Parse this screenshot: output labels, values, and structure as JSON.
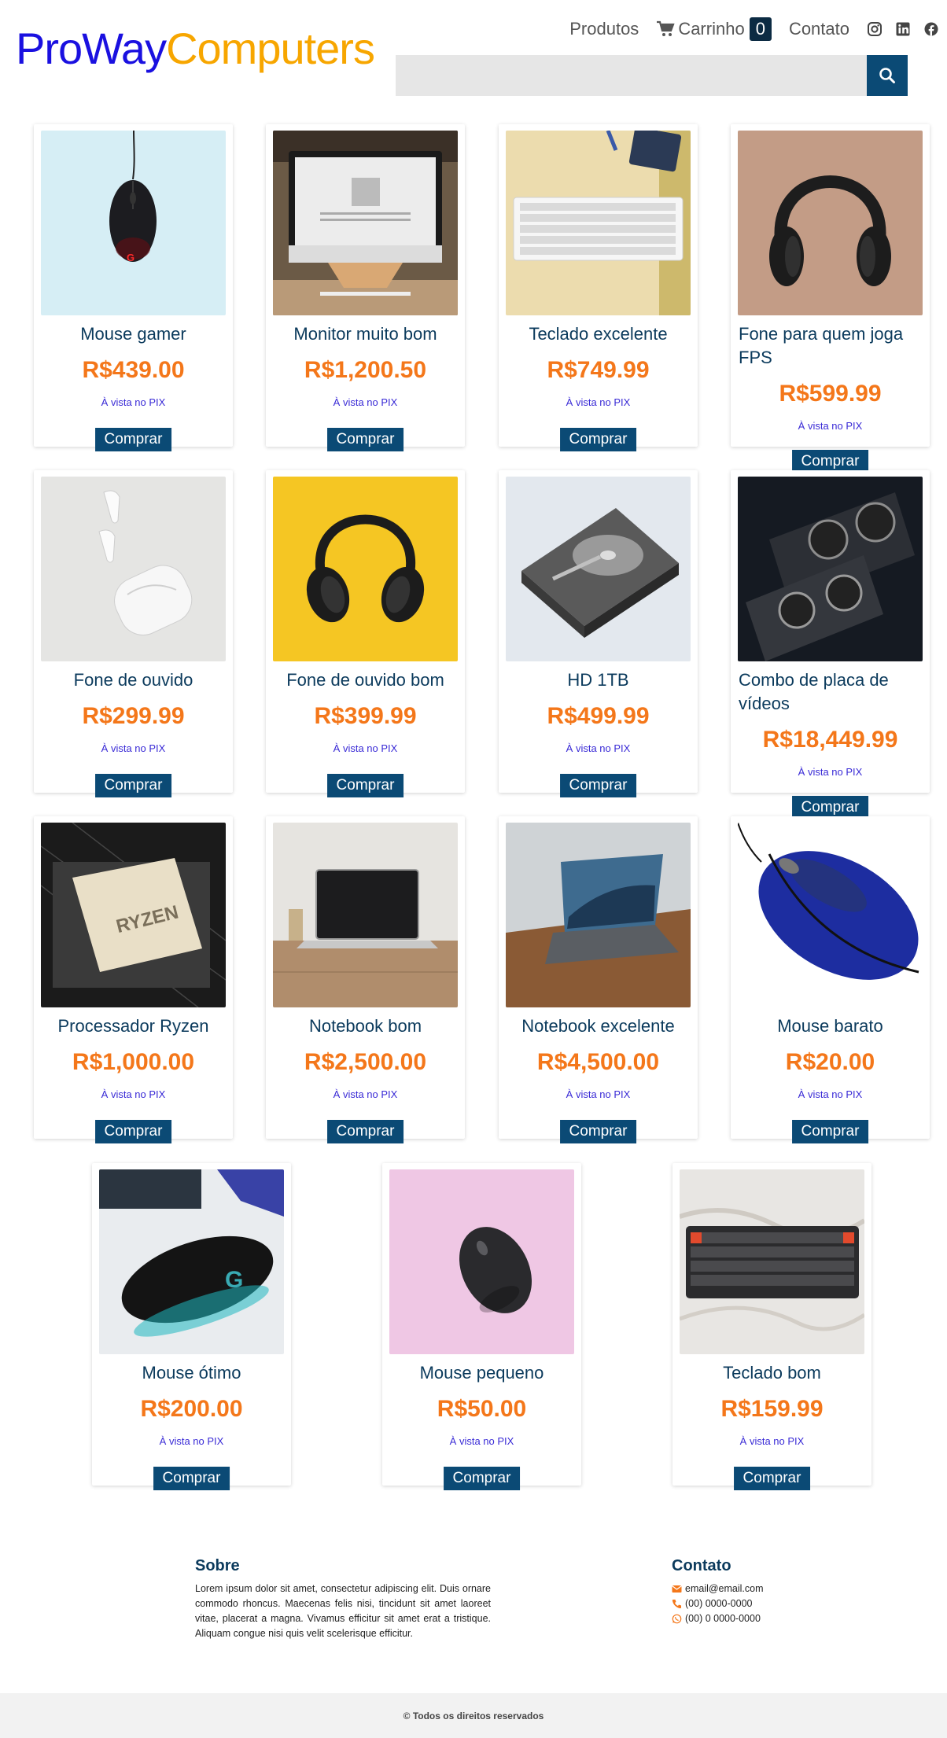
{
  "header": {
    "logo_part1": "ProWay",
    "logo_part2": "Computers",
    "nav": {
      "products": "Produtos",
      "cart": "Carrinho",
      "cart_count": "0",
      "contact": "Contato"
    },
    "social_icons": [
      "instagram-icon",
      "linkedin-icon",
      "facebook-icon"
    ],
    "search": {
      "placeholder": "",
      "value": ""
    }
  },
  "colors": {
    "logo_blue": "#1a10e0",
    "logo_orange": "#f7a600",
    "primary": "#0b4a75",
    "price": "#f4771a",
    "pix": "#3a2bd6"
  },
  "products": [
    {
      "name": "Mouse gamer",
      "price": "R$439.00",
      "pix": "À vista no PIX",
      "button": "Comprar"
    },
    {
      "name": "Monitor muito bom",
      "price": "R$1,200.50",
      "pix": "À vista no PIX",
      "button": "Comprar"
    },
    {
      "name": "Teclado excelente",
      "price": "R$749.99",
      "pix": "À vista no PIX",
      "button": "Comprar"
    },
    {
      "name": "Fone para quem joga FPS",
      "price": "R$599.99",
      "pix": "À vista no PIX",
      "button": "Comprar"
    },
    {
      "name": "Fone de ouvido",
      "price": "R$299.99",
      "pix": "À vista no PIX",
      "button": "Comprar"
    },
    {
      "name": "Fone de ouvido bom",
      "price": "R$399.99",
      "pix": "À vista no PIX",
      "button": "Comprar"
    },
    {
      "name": "HD 1TB",
      "price": "R$499.99",
      "pix": "À vista no PIX",
      "button": "Comprar"
    },
    {
      "name": "Combo de placa de vídeos",
      "price": "R$18,449.99",
      "pix": "À vista no PIX",
      "button": "Comprar"
    },
    {
      "name": "Processador Ryzen",
      "price": "R$1,000.00",
      "pix": "À vista no PIX",
      "button": "Comprar"
    },
    {
      "name": "Notebook bom",
      "price": "R$2,500.00",
      "pix": "À vista no PIX",
      "button": "Comprar"
    },
    {
      "name": "Notebook excelente",
      "price": "R$4,500.00",
      "pix": "À vista no PIX",
      "button": "Comprar"
    },
    {
      "name": "Mouse barato",
      "price": "R$20.00",
      "pix": "À vista no PIX",
      "button": "Comprar"
    },
    {
      "name": "Mouse ótimo",
      "price": "R$200.00",
      "pix": "À vista no PIX",
      "button": "Comprar"
    },
    {
      "name": "Mouse pequeno",
      "price": "R$50.00",
      "pix": "À vista no PIX",
      "button": "Comprar"
    },
    {
      "name": "Teclado bom",
      "price": "R$159.99",
      "pix": "À vista no PIX",
      "button": "Comprar"
    }
  ],
  "product_cpu_label": "RYZEN",
  "footer": {
    "about_title": "Sobre",
    "about_text": "Lorem ipsum dolor sit amet, consectetur adipiscing elit. Duis ornare commodo rhoncus. Maecenas felis nisi, tincidunt sit amet laoreet vitae, placerat a magna. Vivamus efficitur sit amet erat a tristique. Aliquam congue nisi quis velit scelerisque efficitur.",
    "contact_title": "Contato",
    "email": "email@email.com",
    "phone": "(00) 0000-0000",
    "whatsapp": "(00) 0 0000-0000",
    "copyright": "© Todos os direitos reservados"
  }
}
